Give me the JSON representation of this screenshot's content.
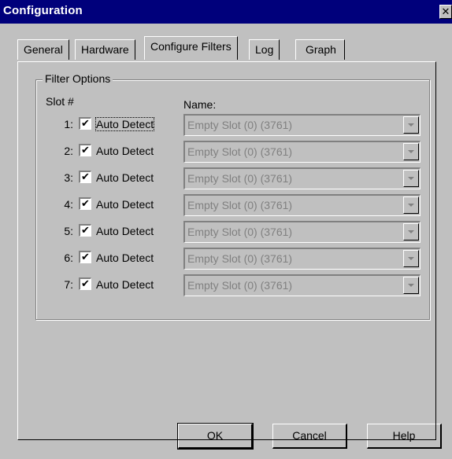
{
  "window": {
    "title": "Configuration",
    "close_glyph": "✕"
  },
  "tabs": [
    {
      "label": "General",
      "active": false
    },
    {
      "label": "Hardware",
      "active": false
    },
    {
      "label": "Configure Filters",
      "active": true
    },
    {
      "label": "Log",
      "active": false
    },
    {
      "label": "Graph",
      "active": false
    }
  ],
  "filter_options": {
    "group_label": "Filter Options",
    "slot_header": "Slot #",
    "name_header": "Name:",
    "slots": [
      {
        "number": "1:",
        "auto_detect_label": "Auto Detect",
        "auto_detect_checked": true,
        "name_value": "Empty Slot (0) (3761)",
        "enabled": false
      },
      {
        "number": "2:",
        "auto_detect_label": "Auto Detect",
        "auto_detect_checked": true,
        "name_value": "Empty Slot (0) (3761)",
        "enabled": false
      },
      {
        "number": "3:",
        "auto_detect_label": "Auto Detect",
        "auto_detect_checked": true,
        "name_value": "Empty Slot (0) (3761)",
        "enabled": false
      },
      {
        "number": "4:",
        "auto_detect_label": "Auto Detect",
        "auto_detect_checked": true,
        "name_value": "Empty Slot (0) (3761)",
        "enabled": false
      },
      {
        "number": "5:",
        "auto_detect_label": "Auto Detect",
        "auto_detect_checked": true,
        "name_value": "Empty Slot (0) (3761)",
        "enabled": false
      },
      {
        "number": "6:",
        "auto_detect_label": "Auto Detect",
        "auto_detect_checked": true,
        "name_value": "Empty Slot (0) (3761)",
        "enabled": false
      },
      {
        "number": "7:",
        "auto_detect_label": "Auto Detect",
        "auto_detect_checked": true,
        "name_value": "Empty Slot (0) (3761)",
        "enabled": false
      }
    ],
    "check_glyph": "✔"
  },
  "buttons": {
    "ok": "OK",
    "cancel": "Cancel",
    "help": "Help"
  },
  "colors": {
    "titlebar": "#00007b",
    "face": "#c0c0c0",
    "disabled_text": "#808080"
  }
}
